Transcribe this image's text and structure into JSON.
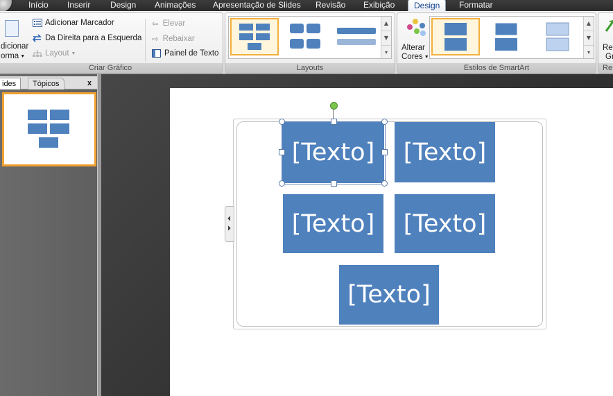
{
  "tabs": [
    {
      "label": "Início"
    },
    {
      "label": "Inserir"
    },
    {
      "label": "Design"
    },
    {
      "label": "Animações"
    },
    {
      "label": "Apresentação de Slides"
    },
    {
      "label": "Revisão"
    },
    {
      "label": "Exibição"
    },
    {
      "label": "Design"
    },
    {
      "label": "Formatar"
    }
  ],
  "ribbon": {
    "criar_grafico": {
      "add_shape_label_1": "dicionar",
      "add_shape_label_2": "orma",
      "add_marker": "Adicionar Marcador",
      "right_to_left": "Da Direita para a Esquerda",
      "layout": "Layout",
      "elevate": "Elevar",
      "demote": "Rebaixar",
      "text_pane": "Painel de Texto",
      "group_label": "Criar Gráfico"
    },
    "layouts": {
      "group_label": "Layouts"
    },
    "estilos": {
      "change_colors_1": "Alterar",
      "change_colors_2": "Cores",
      "group_label": "Estilos de SmartArt"
    },
    "reset": {
      "label_1": "Re",
      "label_2": "Gr",
      "group_label": "Re"
    }
  },
  "pane": {
    "tab_slides": "ides",
    "tab_topics": "Tópicos",
    "close": "x"
  },
  "slide": {
    "boxes": [
      "[Texto]",
      "[Texto]",
      "[Texto]",
      "[Texto]",
      "[Texto]"
    ]
  },
  "colors": {
    "accent": "#4f81bd",
    "selection": "#f0a030",
    "rotate_handle": "#7ac64a"
  }
}
